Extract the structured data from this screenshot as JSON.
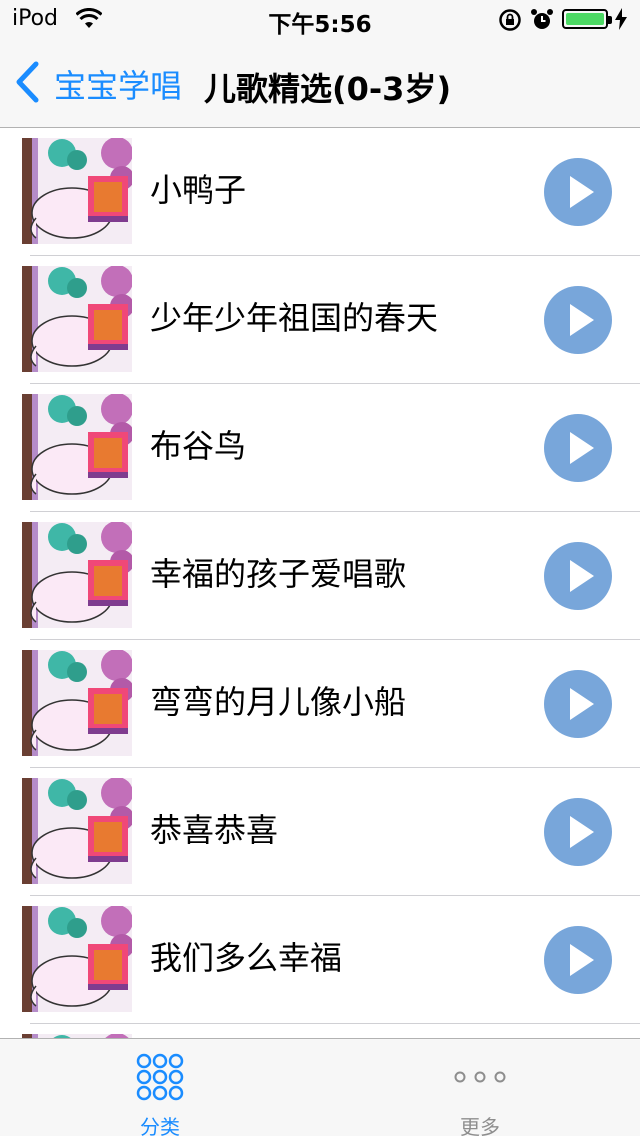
{
  "status_bar": {
    "carrier": "iPod",
    "time": "下午5:56",
    "icons": [
      "wifi-icon",
      "rotation-lock-icon",
      "alarm-icon",
      "battery-icon",
      "charging-bolt-icon"
    ],
    "battery_color": "#4cd964"
  },
  "nav": {
    "back_label": "宝宝学唱",
    "title": "儿歌精选(0-3岁)",
    "accent_color": "#1a8cff"
  },
  "songs": [
    {
      "title": "小鸭子"
    },
    {
      "title": "少年少年祖国的春天"
    },
    {
      "title": "布谷鸟"
    },
    {
      "title": "幸福的孩子爱唱歌"
    },
    {
      "title": "弯弯的月儿像小船"
    },
    {
      "title": "恭喜恭喜"
    },
    {
      "title": "我们多么幸福"
    },
    {
      "title": ""
    }
  ],
  "play_button_color": "#78a6da",
  "tabs": [
    {
      "label": "分类",
      "icon": "grid-icon",
      "active": true
    },
    {
      "label": "更多",
      "icon": "more-icon",
      "active": false
    }
  ]
}
